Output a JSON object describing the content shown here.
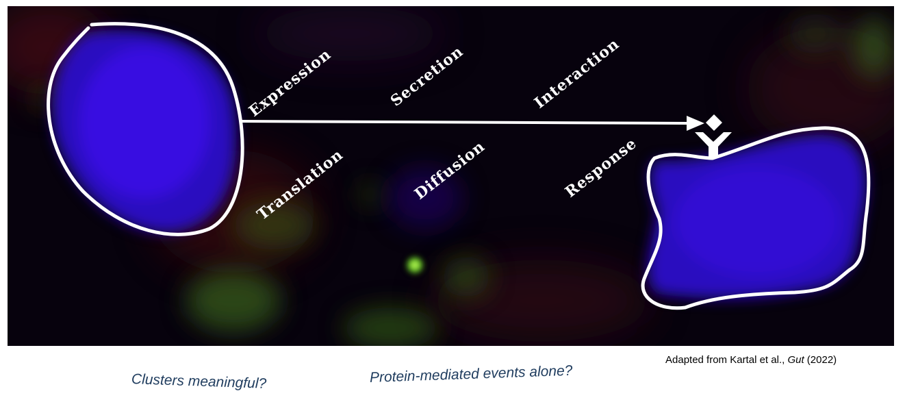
{
  "labels": {
    "top": [
      "Expression",
      "Secretion",
      "Interaction"
    ],
    "bottom": [
      "Translation",
      "Diffusion",
      "Response"
    ]
  },
  "citation": {
    "prefix": "Adapted from Kartal et al., ",
    "journal": "Gut",
    "year": " (2022)"
  },
  "questions": {
    "clusters": "Clusters meaningful?",
    "protein": "Protein-mediated events alone?"
  },
  "colors": {
    "background": "#07020d",
    "nucleus": "#3a10e0",
    "green_signal": "#4fb02a",
    "red_signal": "#6a0f14",
    "outline": "#ffffff",
    "question_text": "#1f3c5e"
  }
}
